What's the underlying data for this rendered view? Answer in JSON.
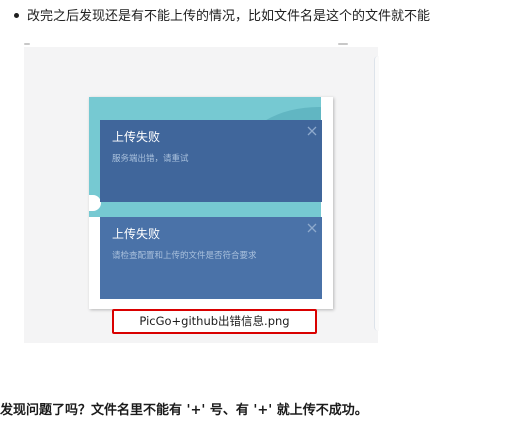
{
  "article": {
    "bullet_text": "改完之后发现还是有不能上传的情况，比如文件名是这个的文件就不能",
    "screenshot": {
      "toasts": [
        {
          "title": "上传失败",
          "message": "服务端出错，请重试"
        },
        {
          "title": "上传失败",
          "message": "请检查配置和上传的文件是否符合要求"
        }
      ],
      "caption": "PicGo+github出错信息.png"
    },
    "question": "发现问题了吗？文件名里不能有 '+' 号、有 '+' 就上传不成功。"
  },
  "icons": {
    "close": "close-icon"
  },
  "colors": {
    "toast_bg": "#40669b",
    "caption_border": "#d90000",
    "teal": "#76c9d2"
  }
}
